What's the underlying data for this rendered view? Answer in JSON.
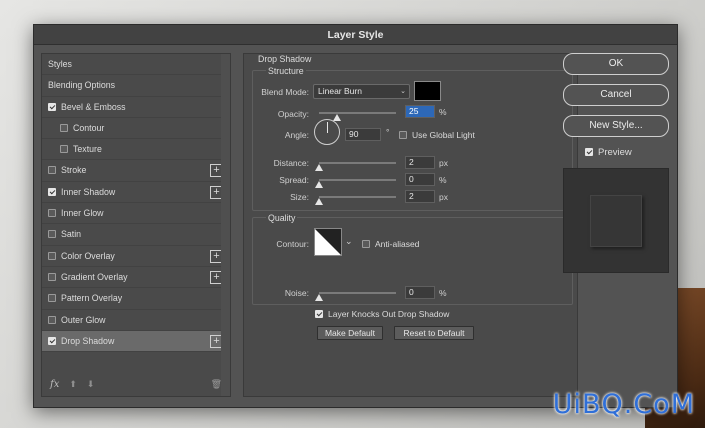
{
  "watermark": "UiBQ.CoM",
  "dialog": {
    "title": "Layer Style"
  },
  "left_panel": {
    "items": [
      {
        "label": "Styles",
        "checkbox": null,
        "plus": false,
        "sub": false
      },
      {
        "label": "Blending Options",
        "checkbox": null,
        "plus": false,
        "sub": false
      },
      {
        "label": "Bevel & Emboss",
        "checkbox": true,
        "plus": false,
        "sub": false
      },
      {
        "label": "Contour",
        "checkbox": false,
        "plus": false,
        "sub": true
      },
      {
        "label": "Texture",
        "checkbox": false,
        "plus": false,
        "sub": true
      },
      {
        "label": "Stroke",
        "checkbox": false,
        "plus": true,
        "sub": false
      },
      {
        "label": "Inner Shadow",
        "checkbox": true,
        "plus": true,
        "sub": false
      },
      {
        "label": "Inner Glow",
        "checkbox": false,
        "plus": false,
        "sub": false
      },
      {
        "label": "Satin",
        "checkbox": false,
        "plus": false,
        "sub": false
      },
      {
        "label": "Color Overlay",
        "checkbox": false,
        "plus": true,
        "sub": false
      },
      {
        "label": "Gradient Overlay",
        "checkbox": false,
        "plus": true,
        "sub": false
      },
      {
        "label": "Pattern Overlay",
        "checkbox": false,
        "plus": false,
        "sub": false
      },
      {
        "label": "Outer Glow",
        "checkbox": false,
        "plus": false,
        "sub": false
      },
      {
        "label": "Drop Shadow",
        "checkbox": true,
        "plus": true,
        "sub": false,
        "active": true
      }
    ],
    "footer": {
      "fx": "fx",
      "up": "⬆",
      "down": "⬇",
      "trash": "🗑"
    }
  },
  "drop_shadow": {
    "heading": "Drop Shadow",
    "structure_heading": "Structure",
    "blend_mode_label": "Blend Mode:",
    "blend_mode_value": "Linear Burn",
    "shadow_color": "#000000",
    "opacity_label": "Opacity:",
    "opacity_value": "25",
    "opacity_unit": "%",
    "angle_label": "Angle:",
    "angle_value": "90",
    "angle_unit": "°",
    "global_light_label": "Use Global Light",
    "distance_label": "Distance:",
    "distance_value": "2",
    "distance_unit": "px",
    "spread_label": "Spread:",
    "spread_value": "0",
    "spread_unit": "%",
    "size_label": "Size:",
    "size_value": "2",
    "size_unit": "px",
    "quality_heading": "Quality",
    "contour_label": "Contour:",
    "anti_aliased_label": "Anti-aliased",
    "noise_label": "Noise:",
    "noise_value": "0",
    "noise_unit": "%",
    "knockout_label": "Layer Knocks Out Drop Shadow",
    "make_default_label": "Make Default",
    "reset_default_label": "Reset to Default"
  },
  "right_panel": {
    "ok_label": "OK",
    "cancel_label": "Cancel",
    "new_style_label": "New Style...",
    "preview_label": "Preview"
  },
  "colors": {
    "accent": "#2d68b8",
    "dialog_bg": "#535353",
    "panel_bg": "#4a4a4a"
  }
}
